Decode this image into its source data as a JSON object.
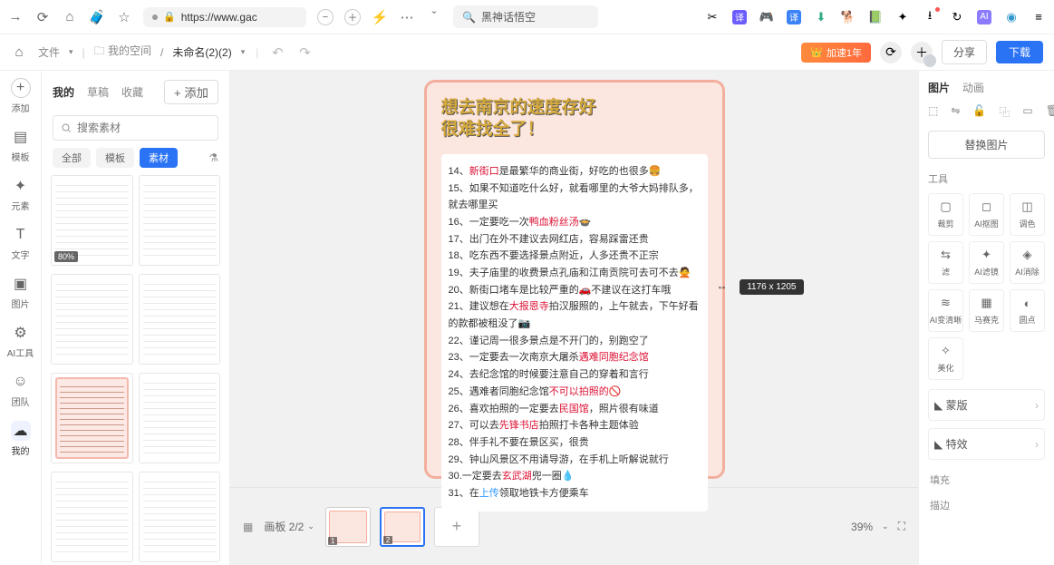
{
  "browser": {
    "url": "https://www.gac",
    "search": "黑神话悟空"
  },
  "appbar": {
    "file": "文件",
    "space": "我的空间",
    "docname": "未命名(2)(2)",
    "vip": "加速1年",
    "share": "分享",
    "download": "下载"
  },
  "rail": {
    "add": "添加",
    "template": "模板",
    "element": "元素",
    "text": "文字",
    "image": "图片",
    "ai": "AI工具",
    "team": "团队",
    "mine": "我的"
  },
  "left": {
    "tab_mine": "我的",
    "tab_draft": "草稿",
    "tab_fav": "收藏",
    "add": "+ 添加",
    "search_ph": "搜索素材",
    "f_all": "全部",
    "f_tpl": "模板",
    "f_mat": "素材",
    "thumb1": "80%"
  },
  "canvas": {
    "title_l1": "想去南京的速度存好",
    "title_l2": "很难找全了！",
    "lines": [
      "14、<r>新街口</r>是最繁华的商业街，好吃的也很多🍔",
      "15、如果不知道吃什么好，就看哪里的大爷大妈排队多，就去哪里买",
      "16、一定要吃一次<r>鸭血粉丝汤</r>🍲",
      "17、出门在外不建议去网红店，容易踩雷还贵",
      "18、吃东西不要选择景点附近，人多还贵不正宗",
      "19、夫子庙里的收费景点孔庙和江南贡院可去可不去🙅",
      "20、新街口堵车是比较严重的🚗不建议在这打车哦",
      "21、建议想在<r>大报恩寺</r>拍汉服照的，上午就去，下午好看的款都被租没了📷",
      "22、谨记周一很多景点是不开门的，别跑空了",
      "23、一定要去一次南京大屠杀<r>遇难同胞纪念馆</r>",
      "24、去纪念馆的时候要注意自己的穿着和言行",
      "25、遇难者同胞纪念馆<r>不可以拍照的</r>🚫",
      "26、喜欢拍照的一定要去<r>民国馆</r>，照片很有味道",
      "27、可以去<r>先锋书店</r>拍照打卡各种主题体验",
      "28、伴手礼不要在景区买，很贵",
      "29、钟山风景区不用请导游，在手机上听解说就行",
      "30.一定要去<r>玄武湖</r>兜一圈💧",
      "31、在<b>上传</b>领取地铁卡方便乘车"
    ],
    "size_tip": "1176 x 1205",
    "page_ind": "画板 2/2",
    "zoom": "39%"
  },
  "right": {
    "tab_img": "图片",
    "tab_anim": "动画",
    "replace": "替换图片",
    "sec_tools": "工具",
    "tools": [
      {
        "ico": "▢",
        "l": "裁剪"
      },
      {
        "ico": "◻",
        "l": "AI抠图"
      },
      {
        "ico": "◫",
        "l": "调色"
      },
      {
        "ico": "⇆",
        "l": "滤"
      },
      {
        "ico": "✦",
        "l": "AI滤镜"
      },
      {
        "ico": "◈",
        "l": "AI消除"
      },
      {
        "ico": "≋",
        "l": "AI变清晰"
      },
      {
        "ico": "",
        "l": ""
      },
      {
        "ico": "▦",
        "l": "马赛克"
      },
      {
        "ico": "◐",
        "l": "圆点"
      },
      {
        "ico": "✧",
        "l": "美化"
      },
      {
        "ico": "",
        "l": ""
      }
    ],
    "mask": "蒙版",
    "fx": "特效",
    "fill": "填充",
    "stroke": "描边"
  }
}
